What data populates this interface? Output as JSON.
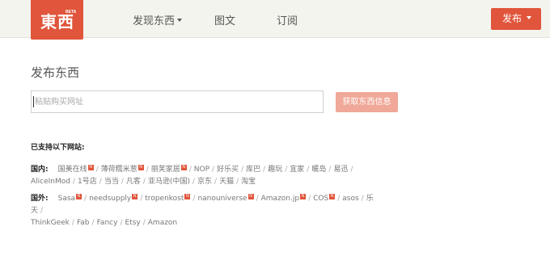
{
  "header": {
    "logo_text": "東西",
    "logo_beta": "BETA",
    "nav": {
      "discover": "发现东西",
      "tuwen": "图文",
      "subscribe": "订阅"
    },
    "publish_label": "发布"
  },
  "main": {
    "title": "发布东西",
    "url_input": {
      "placeholder": "粘贴购买网址",
      "value": ""
    },
    "fetch_button": "获取东西信息",
    "supported_title": "已支持以下网站:"
  },
  "domestic": {
    "label": "国内:",
    "sites": [
      {
        "name": "国美在线",
        "new": true
      },
      {
        "name": "薄荷糯米葱",
        "new": true
      },
      {
        "name": "丽芙家居",
        "new": true
      },
      {
        "name": "NOP",
        "new": false
      },
      {
        "name": "好乐买",
        "new": false
      },
      {
        "name": "库巴",
        "new": false
      },
      {
        "name": "趣玩",
        "new": false
      },
      {
        "name": "宜家",
        "new": false
      },
      {
        "name": "暖岛",
        "new": false
      },
      {
        "name": "易迅",
        "new": false
      },
      {
        "name": "AliceInMod",
        "new": false
      },
      {
        "name": "1号店",
        "new": false
      },
      {
        "name": "当当",
        "new": false
      },
      {
        "name": "凡客",
        "new": false
      },
      {
        "name": "亚马逊(中国)",
        "new": false
      },
      {
        "name": "京东",
        "new": false
      },
      {
        "name": "天猫",
        "new": false
      },
      {
        "name": "淘宝",
        "new": false
      }
    ]
  },
  "foreign": {
    "label": "国外:",
    "sites": [
      {
        "name": "Sasa",
        "new": true
      },
      {
        "name": "needsupply",
        "new": true
      },
      {
        "name": "tropenkost",
        "new": true
      },
      {
        "name": "nanouniverse",
        "new": true
      },
      {
        "name": "Amazon.jp",
        "new": true
      },
      {
        "name": "COS",
        "new": true
      },
      {
        "name": "asos",
        "new": false
      },
      {
        "name": "乐天",
        "new": false
      },
      {
        "name": "ThinkGeek",
        "new": false
      },
      {
        "name": "Fab",
        "new": false
      },
      {
        "name": "Fancy",
        "new": false
      },
      {
        "name": "Etsy",
        "new": false
      },
      {
        "name": "Amazon",
        "new": false
      }
    ]
  },
  "badge_text": "N",
  "colors": {
    "accent": "#e0553b",
    "accent_light": "#f0a898",
    "topbar_bg": "#f4f4ef"
  },
  "icons": {
    "nav_caret": "caret-down-icon",
    "publish_caret": "caret-down-icon"
  }
}
